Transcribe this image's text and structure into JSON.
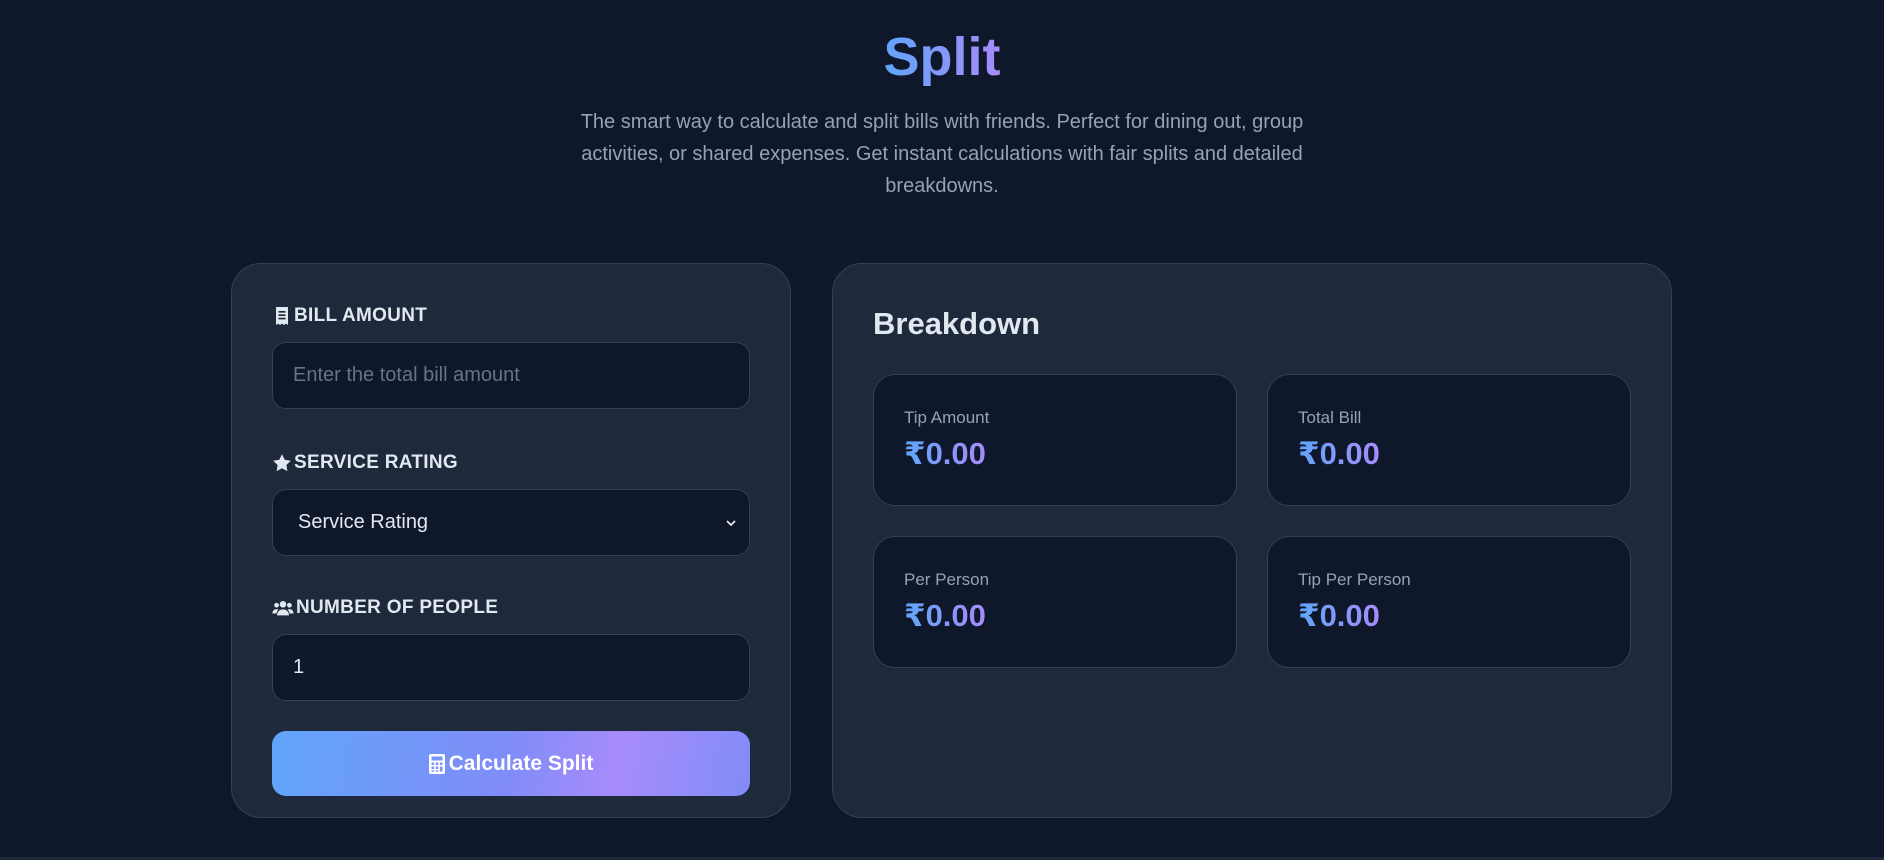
{
  "header": {
    "title": "Split",
    "description": "The smart way to calculate and split bills with friends. Perfect for dining out, group activities, or shared expenses. Get instant calculations with fair splits and detailed breakdowns."
  },
  "form": {
    "bill": {
      "label": "BILL AMOUNT",
      "icon": "receipt-icon",
      "placeholder": "Enter the total bill amount",
      "value": ""
    },
    "service": {
      "label": "SERVICE RATING",
      "icon": "star-icon",
      "selected": "Service Rating"
    },
    "people": {
      "label": "NUMBER OF PEOPLE",
      "icon": "users-icon",
      "value": "1"
    },
    "submit": {
      "label": "Calculate Split",
      "icon": "calculator-icon"
    }
  },
  "breakdown": {
    "title": "Breakdown",
    "stats": [
      {
        "label": "Tip Amount",
        "value": "₹0.00"
      },
      {
        "label": "Total Bill",
        "value": "₹0.00"
      },
      {
        "label": "Per Person",
        "value": "₹0.00"
      },
      {
        "label": "Tip Per Person",
        "value": "₹0.00"
      }
    ]
  },
  "colors": {
    "background": "#0f172a",
    "card": "#1e293b",
    "border": "#334155",
    "accent_start": "#60a5fa",
    "accent_end": "#a78bfa"
  }
}
